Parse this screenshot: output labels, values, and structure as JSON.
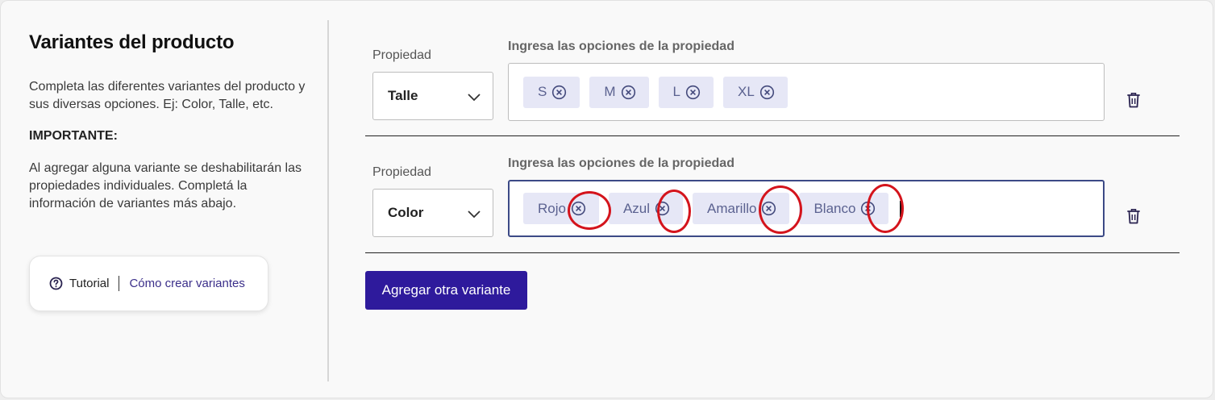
{
  "left": {
    "title": "Variantes del producto",
    "description": "Completa las diferentes variantes del producto y sus diversas opciones. Ej: Color, Talle, etc.",
    "important_heading": "IMPORTANTE:",
    "important_text": "Al agregar alguna variante se deshabilitarán las propiedades individuales. Completá la información de variantes más abajo.",
    "tutorial": {
      "icon": "question-circle-icon",
      "label": "Tutorial",
      "link": "Cómo crear variantes"
    }
  },
  "variants": [
    {
      "property_label": "Propiedad",
      "property_value": "Talle",
      "options_label": "Ingresa las opciones de la propiedad",
      "options": [
        "S",
        "M",
        "L",
        "XL"
      ]
    },
    {
      "property_label": "Propiedad",
      "property_value": "Color",
      "options_label": "Ingresa las opciones de la propiedad",
      "options": [
        "Rojo",
        "Azul",
        "Amarillo",
        "Blanco"
      ]
    }
  ],
  "add_button": "Agregar otra variante",
  "colors": {
    "primary": "#2e1a9c",
    "tag_bg": "#e6e7f6",
    "tag_text": "#5b6290",
    "annotation": "#d4141c"
  }
}
